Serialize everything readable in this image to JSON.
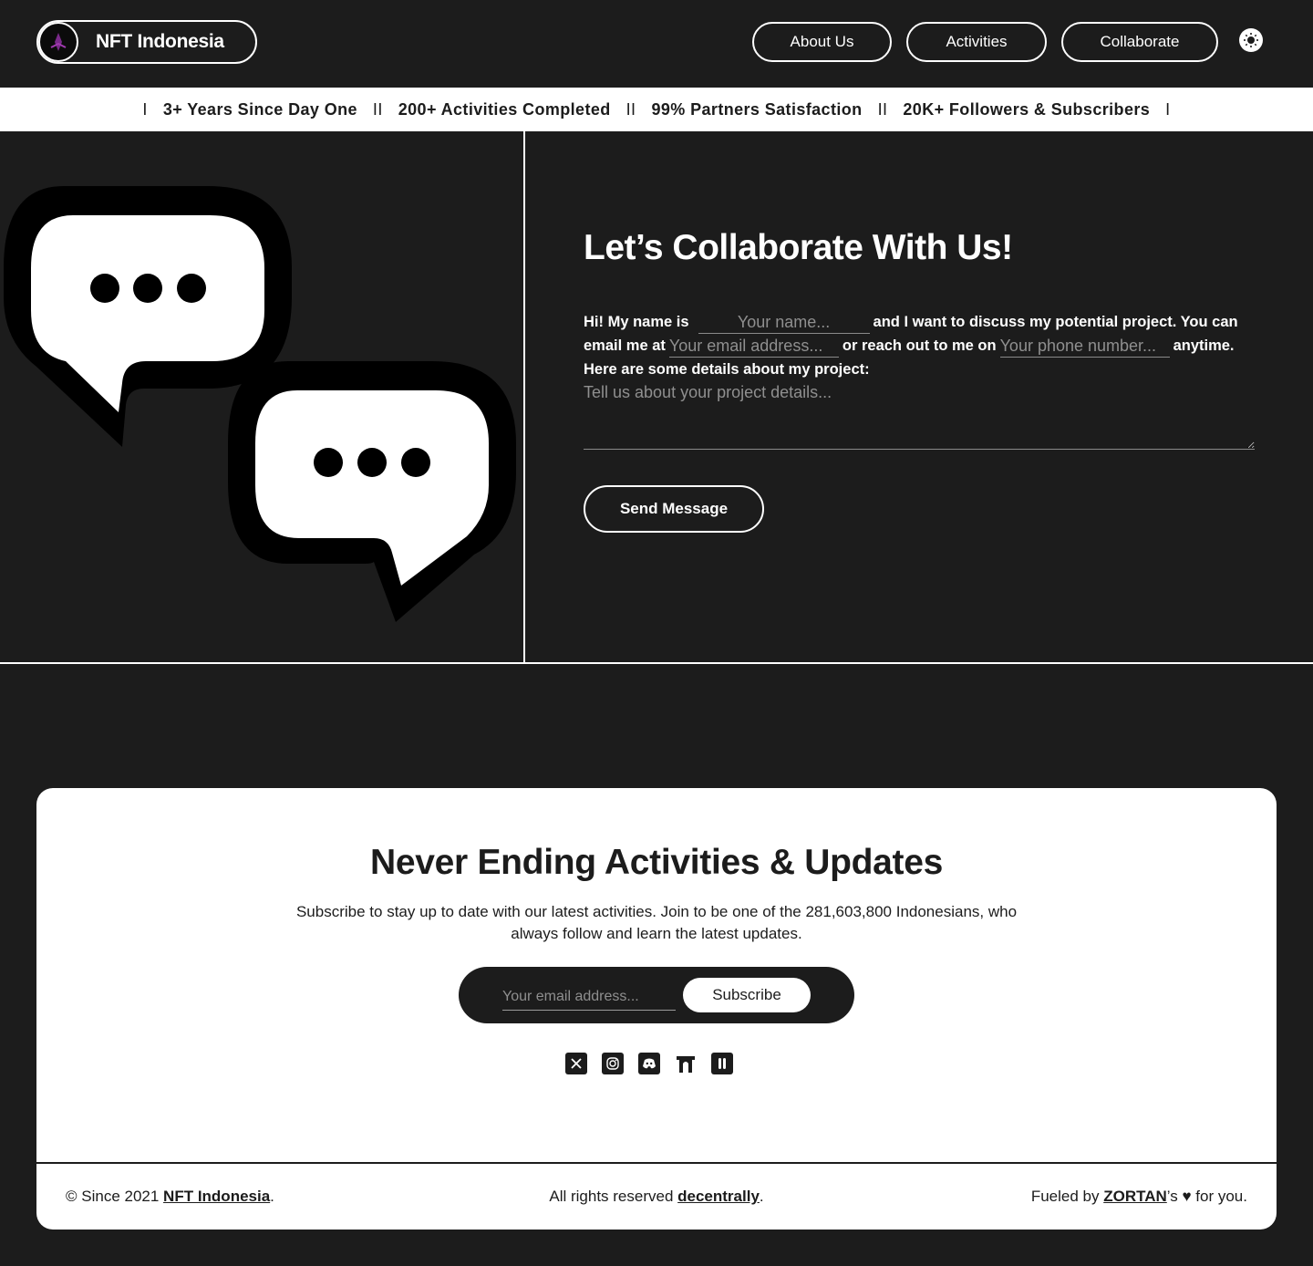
{
  "header": {
    "brand_name": "NFT Indonesia",
    "nav": [
      {
        "label": "About Us"
      },
      {
        "label": "Activities"
      },
      {
        "label": "Collaborate"
      }
    ]
  },
  "ticker": {
    "items": [
      "3+ Years Since Day One",
      "200+ Activities Completed",
      "99% Partners Satisfaction",
      "20K+ Followers & Subscribers"
    ],
    "sep_single": "I",
    "sep_double": "II"
  },
  "collaborate": {
    "title": "Let’s Collaborate With Us!",
    "text_1": "Hi! My name is",
    "name_placeholder": "Your name...",
    "text_2": "and I want to discuss my potential project. You can email me at",
    "email_placeholder": "Your email address...",
    "text_3": "or reach out to me on",
    "phone_placeholder": "Your phone number...",
    "text_4": "anytime. Here are some details about my project:",
    "details_placeholder": "Tell us about your project details...",
    "send_label": "Send Message"
  },
  "newsletter": {
    "title": "Never Ending Activities & Updates",
    "description": "Subscribe to stay up to date with our latest activities. Join to be one of the 281,603,800 Indonesians, who always follow and learn the latest updates.",
    "email_placeholder": "Your email address...",
    "subscribe_label": "Subscribe",
    "socials": [
      "x-icon",
      "instagram-icon",
      "discord-icon",
      "opensea-icon",
      "linktree-icon"
    ]
  },
  "footer": {
    "left_prefix": "© Since 2021 ",
    "left_link": "NFT Indonesia",
    "left_suffix": ".",
    "center_prefix": "All rights reserved ",
    "center_link": "decentrally",
    "center_suffix": ".",
    "right_prefix": "Fueled by ",
    "right_link": "ZORTAN",
    "right_suffix": "’s ♥ for you."
  }
}
